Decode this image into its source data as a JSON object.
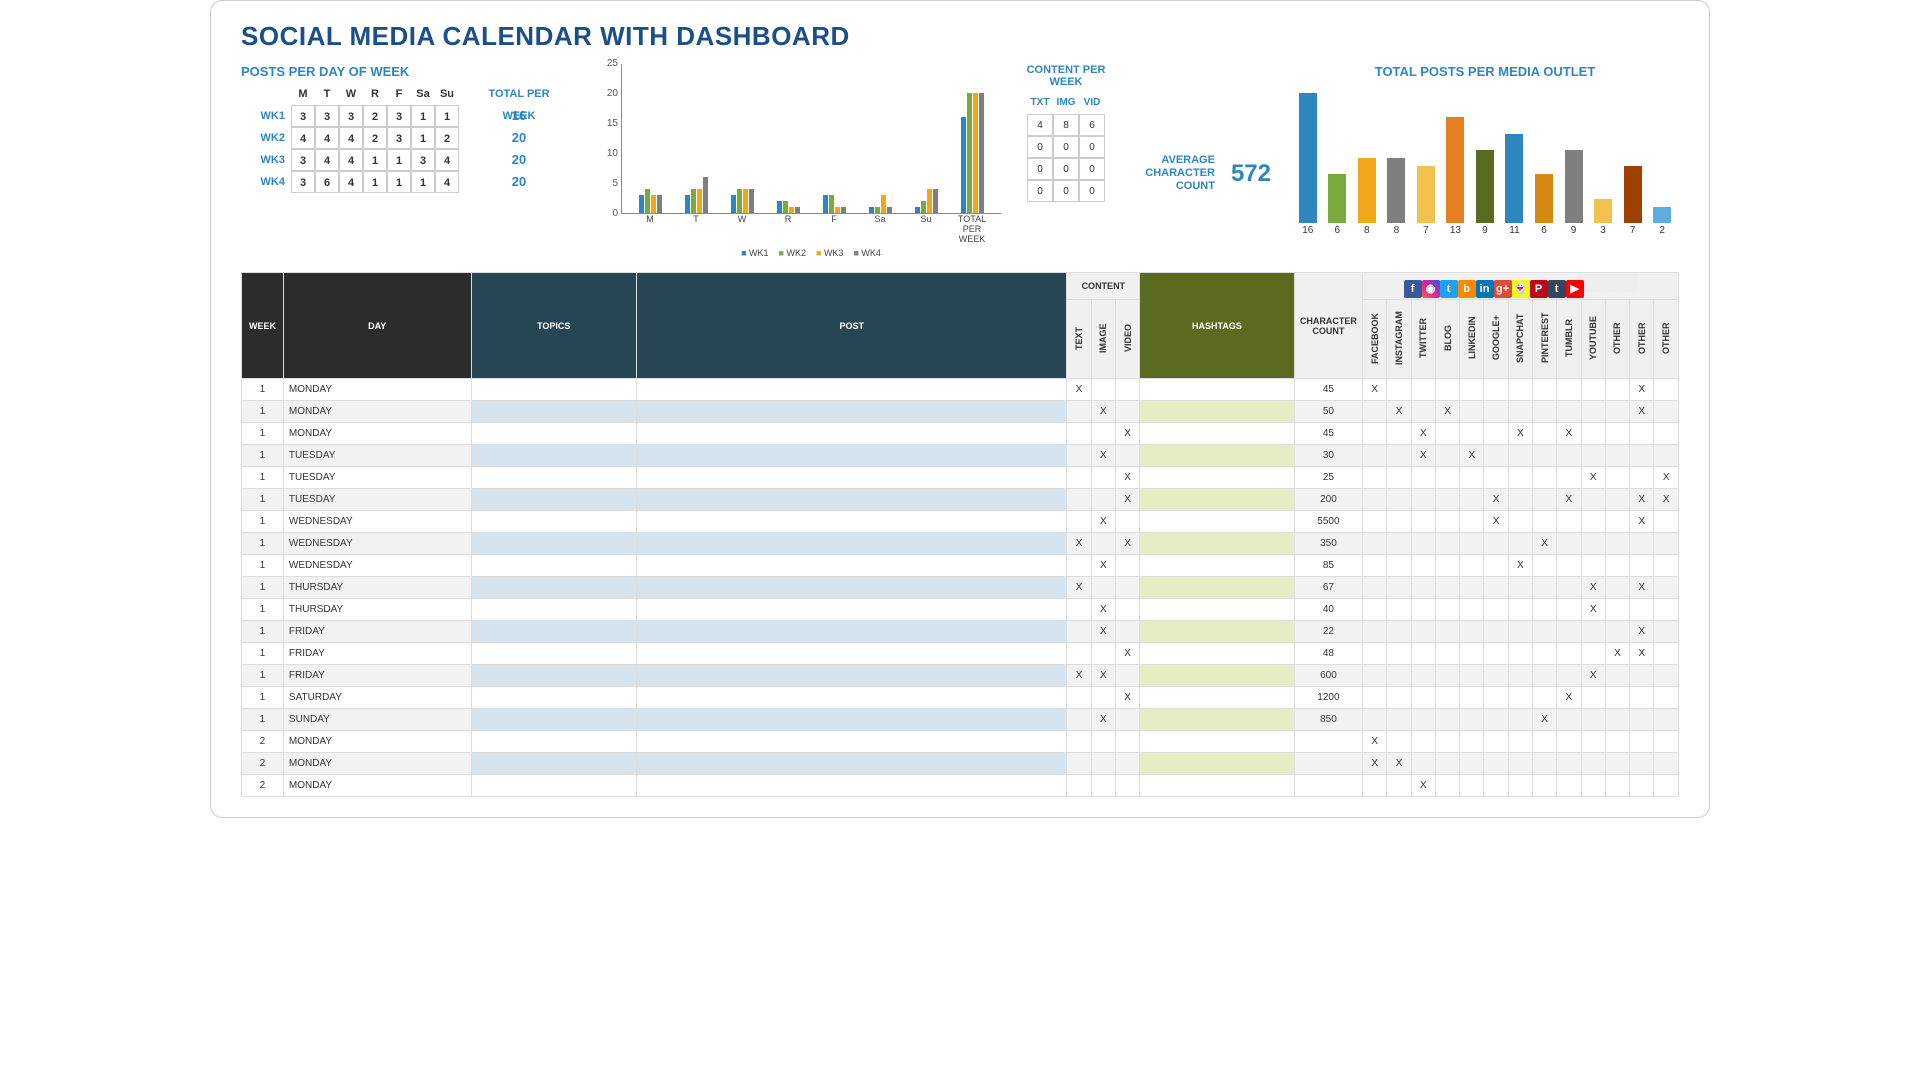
{
  "title": "SOCIAL MEDIA CALENDAR WITH DASHBOARD",
  "ppdow": {
    "title": "POSTS PER DAY OF WEEK",
    "total_label": "TOTAL PER WEEK",
    "days": [
      "M",
      "T",
      "W",
      "R",
      "F",
      "Sa",
      "Su"
    ],
    "rows": [
      {
        "wk": "WK1",
        "v": [
          3,
          3,
          3,
          2,
          3,
          1,
          1
        ],
        "total": 16
      },
      {
        "wk": "WK2",
        "v": [
          4,
          4,
          4,
          2,
          3,
          1,
          2
        ],
        "total": 20
      },
      {
        "wk": "WK3",
        "v": [
          3,
          4,
          4,
          1,
          1,
          3,
          4
        ],
        "total": 20
      },
      {
        "wk": "WK4",
        "v": [
          3,
          6,
          4,
          1,
          1,
          1,
          4
        ],
        "total": 20
      }
    ]
  },
  "chart_data": {
    "type": "bar",
    "title": "",
    "xlabel": "",
    "ylabel": "",
    "ylim": [
      0,
      25
    ],
    "y_ticks": [
      25,
      20,
      15,
      10,
      5,
      0
    ],
    "categories": [
      "M",
      "T",
      "W",
      "R",
      "F",
      "Sa",
      "Su",
      "TOTAL PER WEEK"
    ],
    "series": [
      {
        "name": "WK1",
        "color": "#2E86C1",
        "values": [
          3,
          3,
          3,
          2,
          3,
          1,
          1,
          16
        ]
      },
      {
        "name": "WK2",
        "color": "#7AA93C",
        "values": [
          4,
          4,
          4,
          2,
          3,
          1,
          2,
          20
        ]
      },
      {
        "name": "WK3",
        "color": "#F2A71B",
        "values": [
          3,
          4,
          4,
          1,
          1,
          3,
          4,
          20
        ]
      },
      {
        "name": "WK4",
        "color": "#7F7F7F",
        "values": [
          3,
          6,
          4,
          1,
          1,
          1,
          4,
          20
        ]
      }
    ]
  },
  "cpw": {
    "title": "CONTENT PER WEEK",
    "headers": [
      "TXT",
      "IMG",
      "VID"
    ],
    "rows": [
      [
        4,
        8,
        6
      ],
      [
        0,
        0,
        0
      ],
      [
        0,
        0,
        0
      ],
      [
        0,
        0,
        0
      ]
    ]
  },
  "avg": {
    "label1": "AVERAGE",
    "label2": "CHARACTER",
    "label3": "COUNT",
    "value": "572"
  },
  "outlet": {
    "title": "TOTAL POSTS PER MEDIA OUTLET",
    "bars": [
      {
        "v": 16,
        "color": "#2E86C1"
      },
      {
        "v": 6,
        "color": "#7AA93C"
      },
      {
        "v": 8,
        "color": "#F2A71B"
      },
      {
        "v": 8,
        "color": "#7F7F7F"
      },
      {
        "v": 7,
        "color": "#F2C14E"
      },
      {
        "v": 13,
        "color": "#E67E22"
      },
      {
        "v": 9,
        "color": "#5A6B1F"
      },
      {
        "v": 11,
        "color": "#2E86C1"
      },
      {
        "v": 6,
        "color": "#D68910"
      },
      {
        "v": 9,
        "color": "#7F7F7F"
      },
      {
        "v": 3,
        "color": "#F2C14E"
      },
      {
        "v": 7,
        "color": "#A04000"
      },
      {
        "v": 2,
        "color": "#5DADE2"
      }
    ]
  },
  "table": {
    "headers": {
      "week": "WEEK",
      "day": "DAY",
      "topics": "TOPICS",
      "post": "POST",
      "content": "CONTENT",
      "text": "TEXT",
      "image": "IMAGE",
      "video": "VIDEO",
      "hashtags": "HASHTAGS",
      "char": "CHARACTER COUNT",
      "social": [
        "FACEBOOK",
        "INSTAGRAM",
        "TWITTER",
        "BLOG",
        "LINKEDIN",
        "GOOGLE+",
        "SNAPCHAT",
        "PINTEREST",
        "TUMBLR",
        "YOUTUBE",
        "OTHER",
        "OTHER",
        "OTHER"
      ]
    },
    "icons": [
      "fb",
      "ig",
      "tw",
      "bl",
      "li",
      "gp",
      "sc",
      "pi",
      "tm",
      "yt",
      "ot",
      "ot",
      "ot"
    ],
    "icon_text": [
      "f",
      "◉",
      "t",
      "b",
      "in",
      "g+",
      "👻",
      "P",
      "t",
      "▶",
      "",
      "",
      ""
    ],
    "rows": [
      {
        "wk": 1,
        "day": "MONDAY",
        "txt": "X",
        "img": "",
        "vid": "",
        "cc": 45,
        "s": [
          "X",
          "",
          "",
          "",
          "",
          "",
          "",
          "",
          "",
          "",
          "",
          "X",
          ""
        ]
      },
      {
        "wk": 1,
        "day": "MONDAY",
        "txt": "",
        "img": "X",
        "vid": "",
        "cc": 50,
        "s": [
          "",
          "X",
          "",
          "X",
          "",
          "",
          "",
          "",
          "",
          "",
          "",
          "X",
          ""
        ]
      },
      {
        "wk": 1,
        "day": "MONDAY",
        "txt": "",
        "img": "",
        "vid": "X",
        "cc": 45,
        "s": [
          "",
          "",
          "X",
          "",
          "",
          "",
          "X",
          "",
          "X",
          "",
          "",
          "",
          ""
        ]
      },
      {
        "wk": 1,
        "day": "TUESDAY",
        "txt": "",
        "img": "X",
        "vid": "",
        "cc": 30,
        "s": [
          "",
          "",
          "X",
          "",
          "X",
          "",
          "",
          "",
          "",
          "",
          "",
          "",
          ""
        ]
      },
      {
        "wk": 1,
        "day": "TUESDAY",
        "txt": "",
        "img": "",
        "vid": "X",
        "cc": 25,
        "s": [
          "",
          "",
          "",
          "",
          "",
          "",
          "",
          "",
          "",
          "X",
          "",
          "",
          "X"
        ]
      },
      {
        "wk": 1,
        "day": "TUESDAY",
        "txt": "",
        "img": "",
        "vid": "X",
        "cc": 200,
        "s": [
          "",
          "",
          "",
          "",
          "",
          "X",
          "",
          "",
          "X",
          "",
          "",
          "X",
          "X"
        ]
      },
      {
        "wk": 1,
        "day": "WEDNESDAY",
        "txt": "",
        "img": "X",
        "vid": "",
        "cc": 5500,
        "s": [
          "",
          "",
          "",
          "",
          "",
          "X",
          "",
          "",
          "",
          "",
          "",
          "X",
          ""
        ]
      },
      {
        "wk": 1,
        "day": "WEDNESDAY",
        "txt": "X",
        "img": "",
        "vid": "X",
        "cc": 350,
        "s": [
          "",
          "",
          "",
          "",
          "",
          "",
          "",
          "X",
          "",
          "",
          "",
          "",
          ""
        ]
      },
      {
        "wk": 1,
        "day": "WEDNESDAY",
        "txt": "",
        "img": "X",
        "vid": "",
        "cc": 85,
        "s": [
          "",
          "",
          "",
          "",
          "",
          "",
          "X",
          "",
          "",
          "",
          "",
          "",
          ""
        ]
      },
      {
        "wk": 1,
        "day": "THURSDAY",
        "txt": "X",
        "img": "",
        "vid": "",
        "cc": 67,
        "s": [
          "",
          "",
          "",
          "",
          "",
          "",
          "",
          "",
          "",
          "X",
          "",
          "X",
          ""
        ]
      },
      {
        "wk": 1,
        "day": "THURSDAY",
        "txt": "",
        "img": "X",
        "vid": "",
        "cc": 40,
        "s": [
          "",
          "",
          "",
          "",
          "",
          "",
          "",
          "",
          "",
          "X",
          "",
          "",
          ""
        ]
      },
      {
        "wk": 1,
        "day": "FRIDAY",
        "txt": "",
        "img": "X",
        "vid": "",
        "cc": 22,
        "s": [
          "",
          "",
          "",
          "",
          "",
          "",
          "",
          "",
          "",
          "",
          "",
          "X",
          ""
        ]
      },
      {
        "wk": 1,
        "day": "FRIDAY",
        "txt": "",
        "img": "",
        "vid": "X",
        "cc": 48,
        "s": [
          "",
          "",
          "",
          "",
          "",
          "",
          "",
          "",
          "",
          "",
          "X",
          "X",
          ""
        ]
      },
      {
        "wk": 1,
        "day": "FRIDAY",
        "txt": "X",
        "img": "X",
        "vid": "",
        "cc": 600,
        "s": [
          "",
          "",
          "",
          "",
          "",
          "",
          "",
          "",
          "",
          "X",
          "",
          "",
          ""
        ]
      },
      {
        "wk": 1,
        "day": "SATURDAY",
        "txt": "",
        "img": "",
        "vid": "X",
        "cc": 1200,
        "s": [
          "",
          "",
          "",
          "",
          "",
          "",
          "",
          "",
          "X",
          "",
          "",
          "",
          ""
        ]
      },
      {
        "wk": 1,
        "day": "SUNDAY",
        "txt": "",
        "img": "X",
        "vid": "",
        "cc": 850,
        "s": [
          "",
          "",
          "",
          "",
          "",
          "",
          "",
          "X",
          "",
          "",
          "",
          "",
          ""
        ]
      },
      {
        "wk": 2,
        "day": "MONDAY",
        "txt": "",
        "img": "",
        "vid": "",
        "cc": "",
        "s": [
          "X",
          "",
          "",
          "",
          "",
          "",
          "",
          "",
          "",
          "",
          "",
          "",
          ""
        ]
      },
      {
        "wk": 2,
        "day": "MONDAY",
        "txt": "",
        "img": "",
        "vid": "",
        "cc": "",
        "s": [
          "X",
          "X",
          "",
          "",
          "",
          "",
          "",
          "",
          "",
          "",
          "",
          "",
          ""
        ]
      },
      {
        "wk": 2,
        "day": "MONDAY",
        "txt": "",
        "img": "",
        "vid": "",
        "cc": "",
        "s": [
          "",
          "",
          "X",
          "",
          "",
          "",
          "",
          "",
          "",
          "",
          "",
          "",
          ""
        ]
      }
    ]
  }
}
